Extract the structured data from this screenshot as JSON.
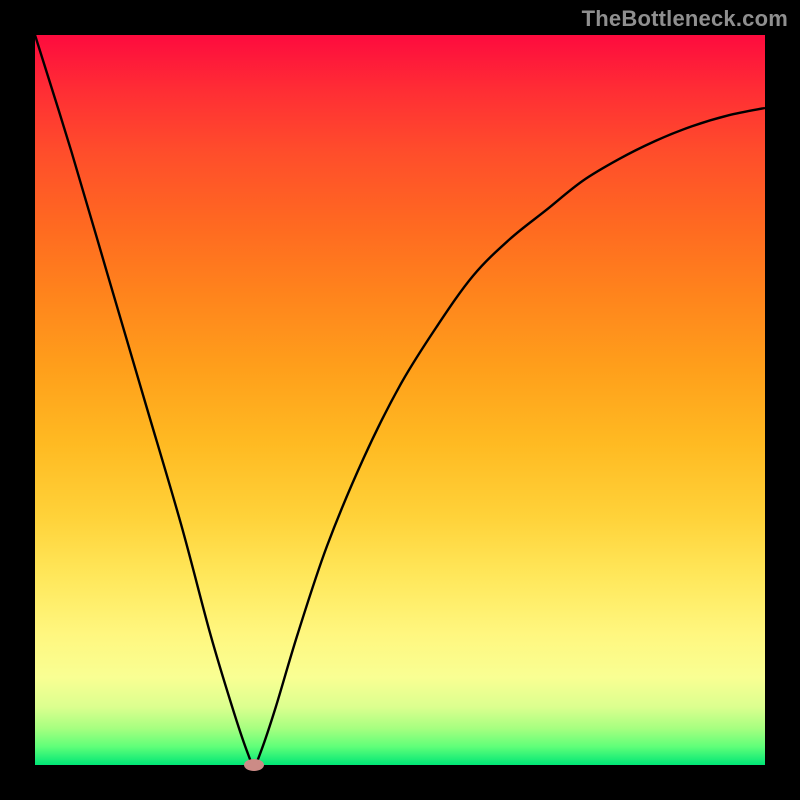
{
  "watermark": "TheBottleneck.com",
  "chart_data": {
    "type": "line",
    "title": "",
    "xlabel": "",
    "ylabel": "",
    "xlim": [
      0,
      100
    ],
    "ylim": [
      0,
      100
    ],
    "grid": false,
    "series": [
      {
        "name": "bottleneck-curve",
        "x": [
          0,
          5,
          10,
          15,
          20,
          24,
          27,
          29,
          30,
          31,
          33,
          36,
          40,
          45,
          50,
          55,
          60,
          65,
          70,
          75,
          80,
          85,
          90,
          95,
          100
        ],
        "values": [
          100,
          84,
          67,
          50,
          33,
          18,
          8,
          2,
          0,
          2,
          8,
          18,
          30,
          42,
          52,
          60,
          67,
          72,
          76,
          80,
          83,
          85.5,
          87.5,
          89,
          90
        ]
      }
    ],
    "marker": {
      "x": 30,
      "y": 0
    },
    "gradient_stops": [
      {
        "pos": 0,
        "color": "#fe0b3e"
      },
      {
        "pos": 50,
        "color": "#ffba22"
      },
      {
        "pos": 88,
        "color": "#f9ff93"
      },
      {
        "pos": 100,
        "color": "#00e676"
      }
    ]
  }
}
